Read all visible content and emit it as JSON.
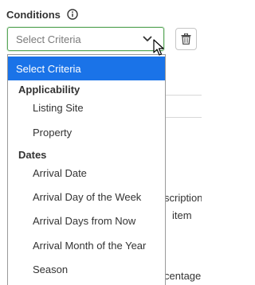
{
  "header": {
    "title": "Conditions"
  },
  "select": {
    "value": "Select Criteria"
  },
  "dropdown": {
    "selected_label": "Select Criteria",
    "groups": [
      {
        "label": "Applicability",
        "items": [
          "Listing Site",
          "Property"
        ]
      },
      {
        "label": "Dates",
        "items": [
          "Arrival Date",
          "Arrival Day of the Week",
          "Arrival Days from Now",
          "Arrival Month of the Year",
          "Season"
        ]
      }
    ]
  },
  "background": {
    "text_1": "scription",
    "text_2": "item",
    "text_3": "centage"
  },
  "colors": {
    "accent": "#1a73e8",
    "select_border": "#5aa75a"
  },
  "icons": {
    "info": "info-circle-icon",
    "chevron": "chevron-down-icon",
    "trash": "trash-icon",
    "cursor": "mouse-pointer-icon"
  }
}
